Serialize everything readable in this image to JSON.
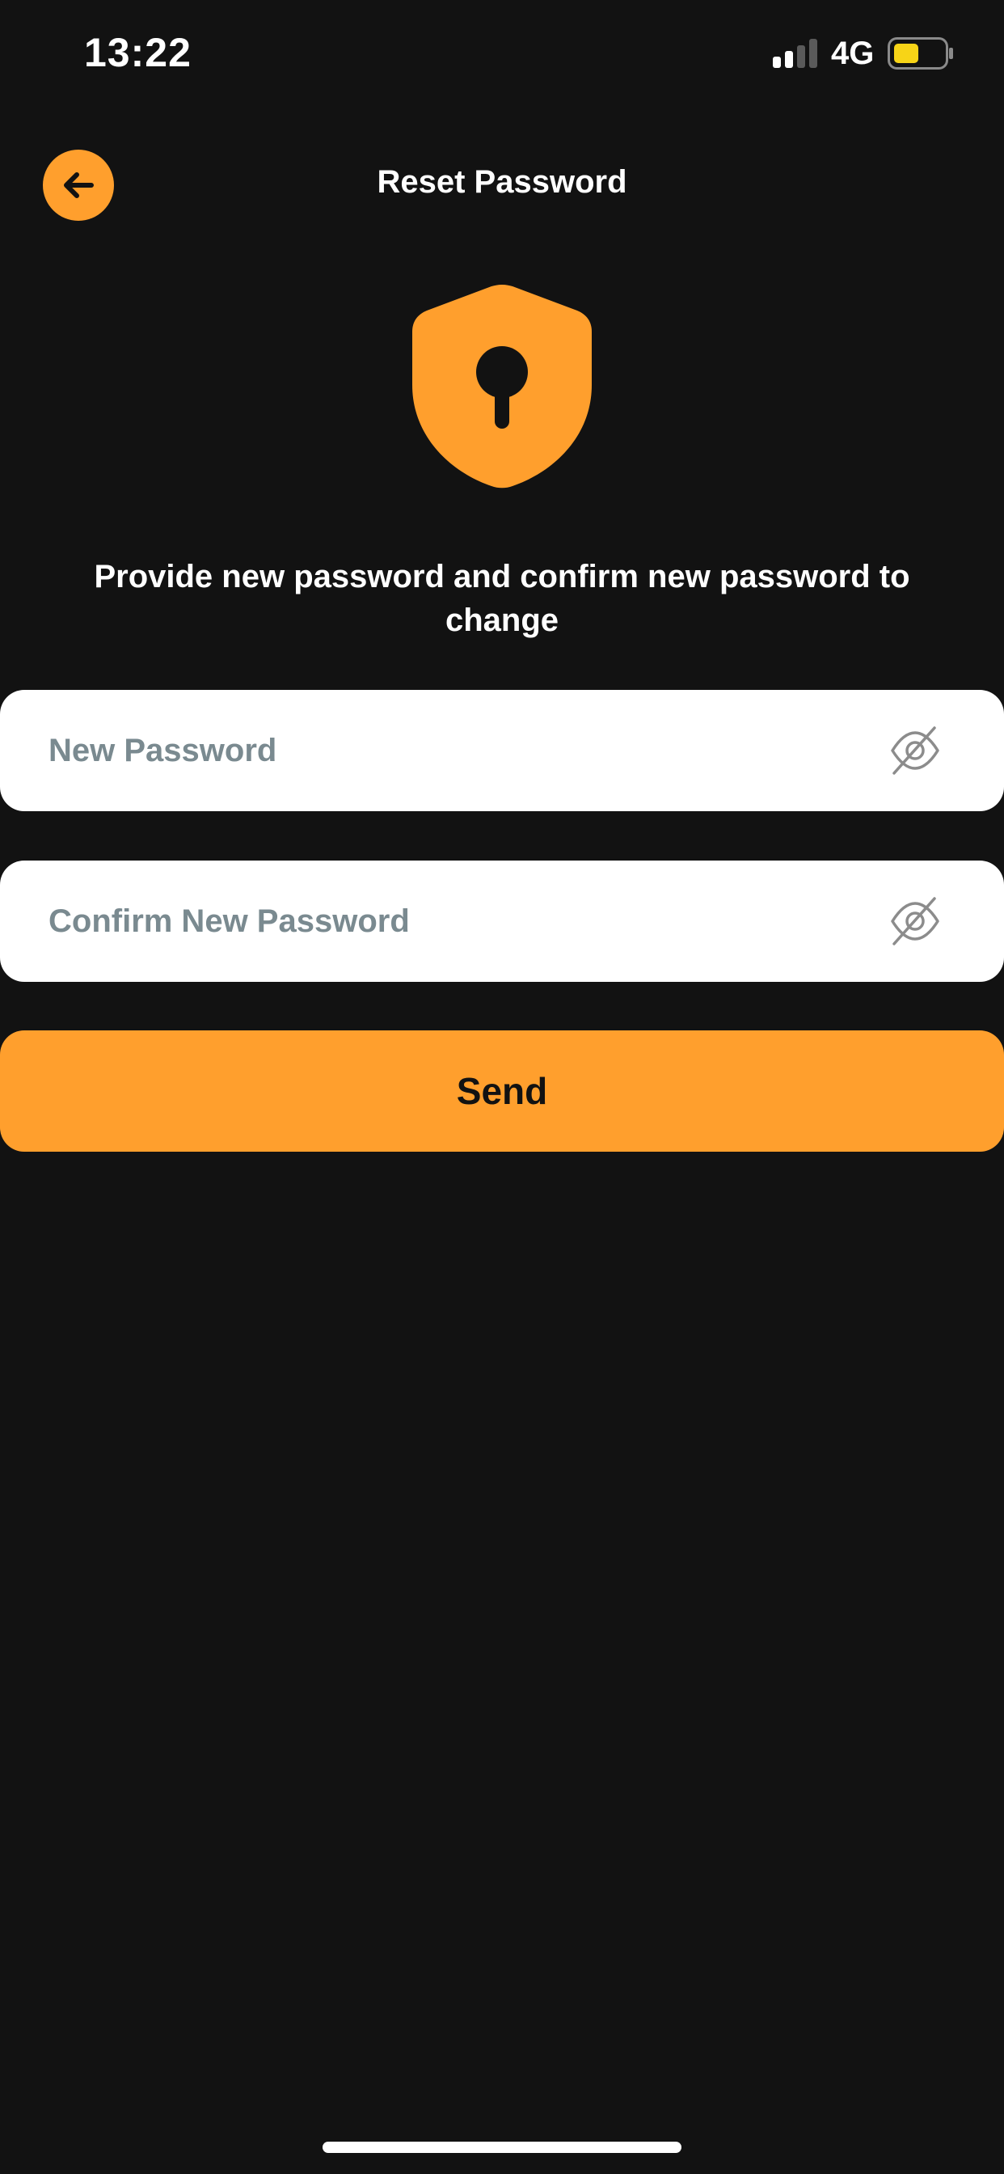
{
  "status_bar": {
    "time": "13:22",
    "network": "4G",
    "battery_color": "#f7d417"
  },
  "header": {
    "title": "Reset Password",
    "back_icon": "arrow-left-icon"
  },
  "illustration": {
    "icon": "shield-keyhole-icon"
  },
  "instruction": "Provide new password and confirm new password to change",
  "form": {
    "new_password": {
      "placeholder": "New Password",
      "value": "",
      "toggle_icon": "eye-off-icon"
    },
    "confirm_password": {
      "placeholder": "Confirm New Password",
      "value": "",
      "toggle_icon": "eye-off-icon"
    },
    "submit_label": "Send"
  },
  "colors": {
    "accent": "#ff9f2d",
    "background": "#121212",
    "field_background": "#ffffff",
    "placeholder": "#7a8a90"
  }
}
